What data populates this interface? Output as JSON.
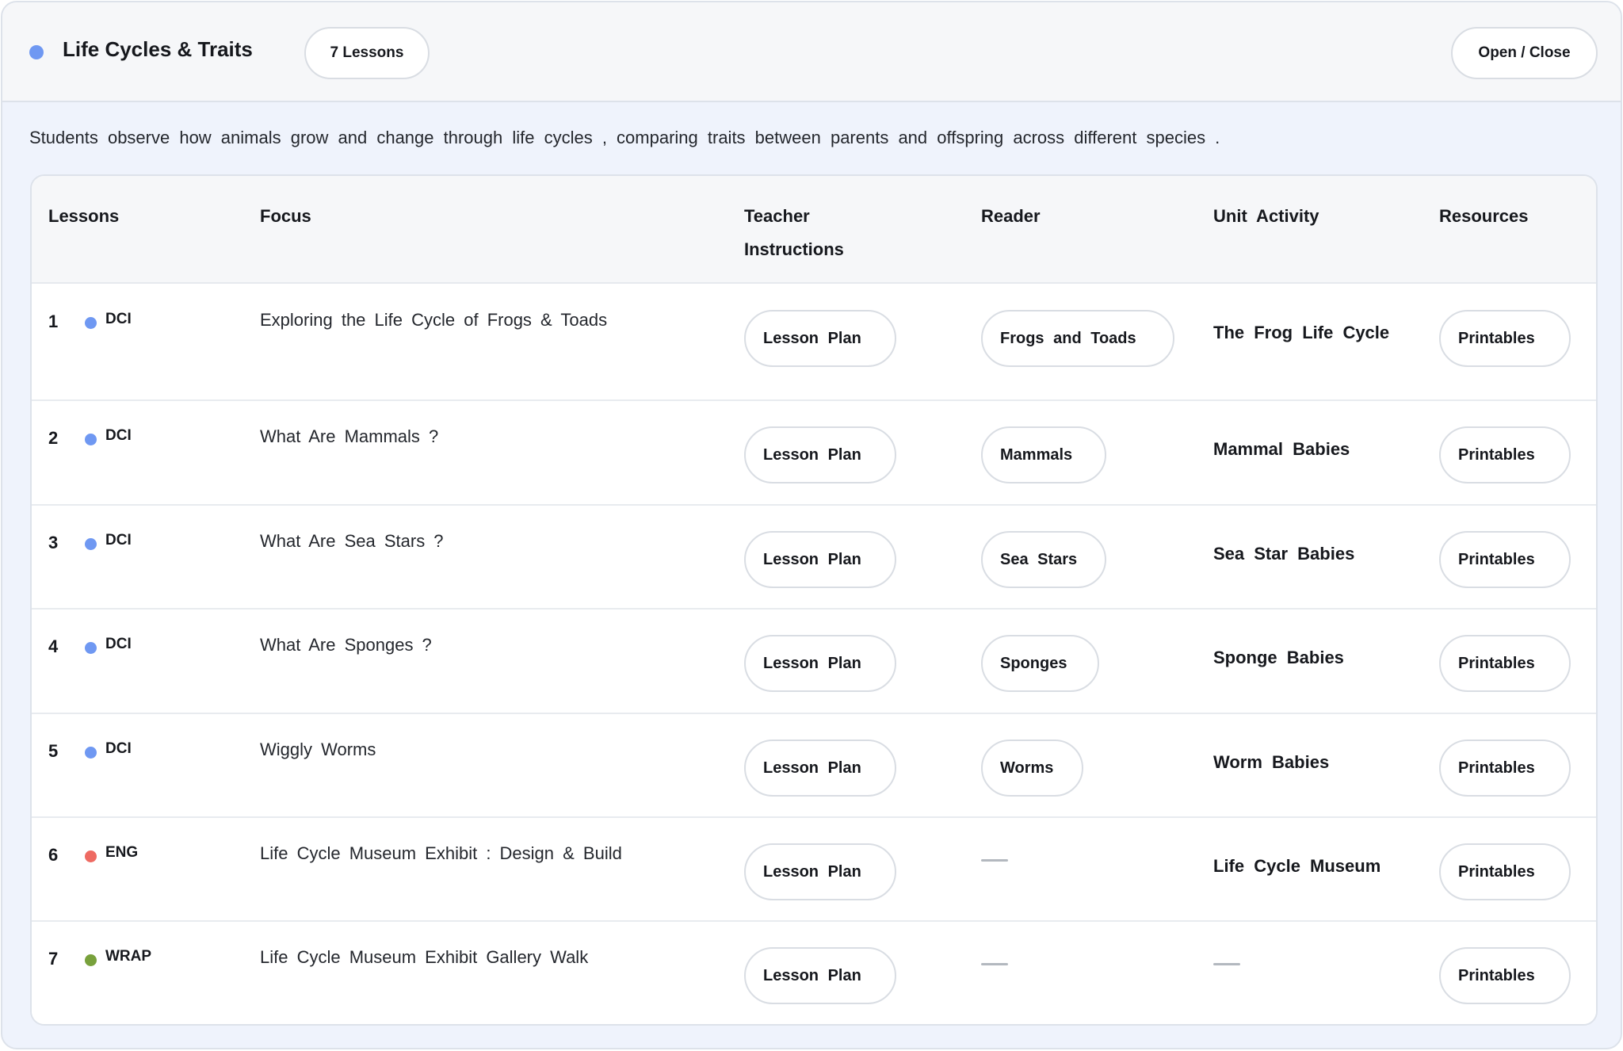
{
  "unit": {
    "title": "Life  Cycles  & Traits",
    "lesson_count": "7  Lessons",
    "toggle_label": "Open  / Close",
    "dot_color": "#6f98f2"
  },
  "summary": "Students  observe  how animals  grow  and  change  through  life cycles , comparing  traits between  parents  and offspring  across  different  species  .",
  "table": {
    "headers": [
      "Lessons",
      "Focus",
      "Teacher Instructions",
      "Reader",
      "Unit  Activity",
      "Resources"
    ],
    "rows": [
      {
        "num": "1",
        "tag": "DCI",
        "tag_color": "#6f98f2",
        "focus": "Exploring  the Life Cycle  of Frogs  & Toads",
        "teacher": "Lesson  Plan",
        "reader": "Frogs  and  Toads",
        "activity": "The  Frog  Life Cycle",
        "resources": "Printables"
      },
      {
        "num": "2",
        "tag": "DCI",
        "tag_color": "#6f98f2",
        "focus": "What  Are  Mammals  ?",
        "teacher": "Lesson  Plan",
        "reader": "Mammals",
        "activity": "Mammal  Babies",
        "resources": "Printables"
      },
      {
        "num": "3",
        "tag": "DCI",
        "tag_color": "#6f98f2",
        "focus": "What  Are  Sea  Stars ?",
        "teacher": "Lesson  Plan",
        "reader": "Sea  Stars",
        "activity": "Sea  Star  Babies",
        "resources": "Printables"
      },
      {
        "num": "4",
        "tag": "DCI",
        "tag_color": "#6f98f2",
        "focus": "What  Are  Sponges  ?",
        "teacher": "Lesson  Plan",
        "reader": "Sponges",
        "activity": "Sponge  Babies",
        "resources": "Printables"
      },
      {
        "num": "5",
        "tag": "DCI",
        "tag_color": "#6f98f2",
        "focus": "Wiggly  Worms",
        "teacher": "Lesson  Plan",
        "reader": "Worms",
        "activity": "Worm  Babies",
        "resources": "Printables"
      },
      {
        "num": "6",
        "tag": "ENG",
        "tag_color": "#ee6a62",
        "focus": "Life  Cycle  Museum  Exhibit : Design  & Build",
        "teacher": "Lesson  Plan",
        "reader": "",
        "activity": "Life  Cycle  Museum",
        "resources": "Printables"
      },
      {
        "num": "7",
        "tag": "WRAP",
        "tag_color": "#78a13c",
        "focus": "Life  Cycle  Museum  Exhibit  Gallery  Walk",
        "teacher": "Lesson  Plan",
        "reader": "",
        "activity": "",
        "resources": "Printables"
      }
    ]
  }
}
